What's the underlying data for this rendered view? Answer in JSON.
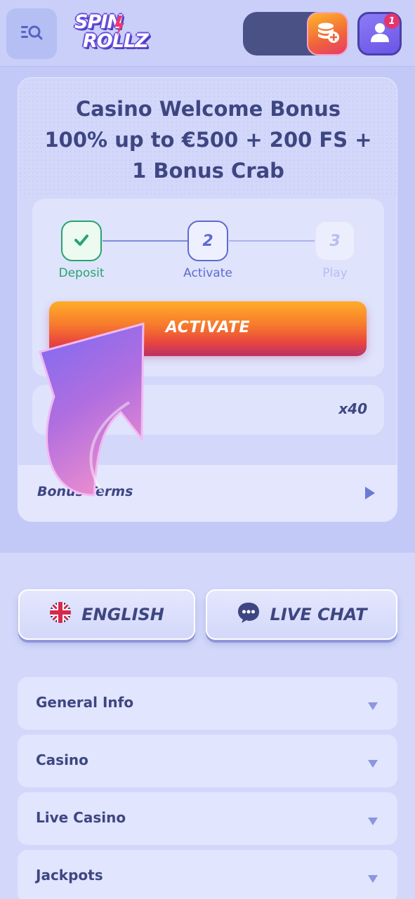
{
  "header": {
    "logo_line1": "SPIN",
    "logo_line2": "ROLLZ",
    "notification_count": "1",
    "icons": {
      "menu": "menu-search-icon",
      "wallet_add": "coins-plus-icon",
      "profile": "user-icon"
    },
    "colors": {
      "accent_orange": "#f77b2d",
      "accent_purple": "#6a55e6",
      "badge": "#e2356c"
    }
  },
  "bonus": {
    "title_line1": "Casino Welcome Bonus",
    "title_line2": "100% up to €500 + 200 FS +",
    "title_line3": "1 Bonus Crab",
    "steps": [
      {
        "number": "",
        "label": "Deposit",
        "state": "done"
      },
      {
        "number": "2",
        "label": "Activate",
        "state": "active"
      },
      {
        "number": "3",
        "label": "Play",
        "state": "next"
      }
    ],
    "activate_label": "ACTIVATE",
    "wager": "x40",
    "terms_label": "Bonus Terms"
  },
  "footer": {
    "language_label": "ENGLISH",
    "livechat_label": "LIVE CHAT",
    "sections": [
      "General Info",
      "Casino",
      "Live Casino",
      "Jackpots"
    ]
  }
}
